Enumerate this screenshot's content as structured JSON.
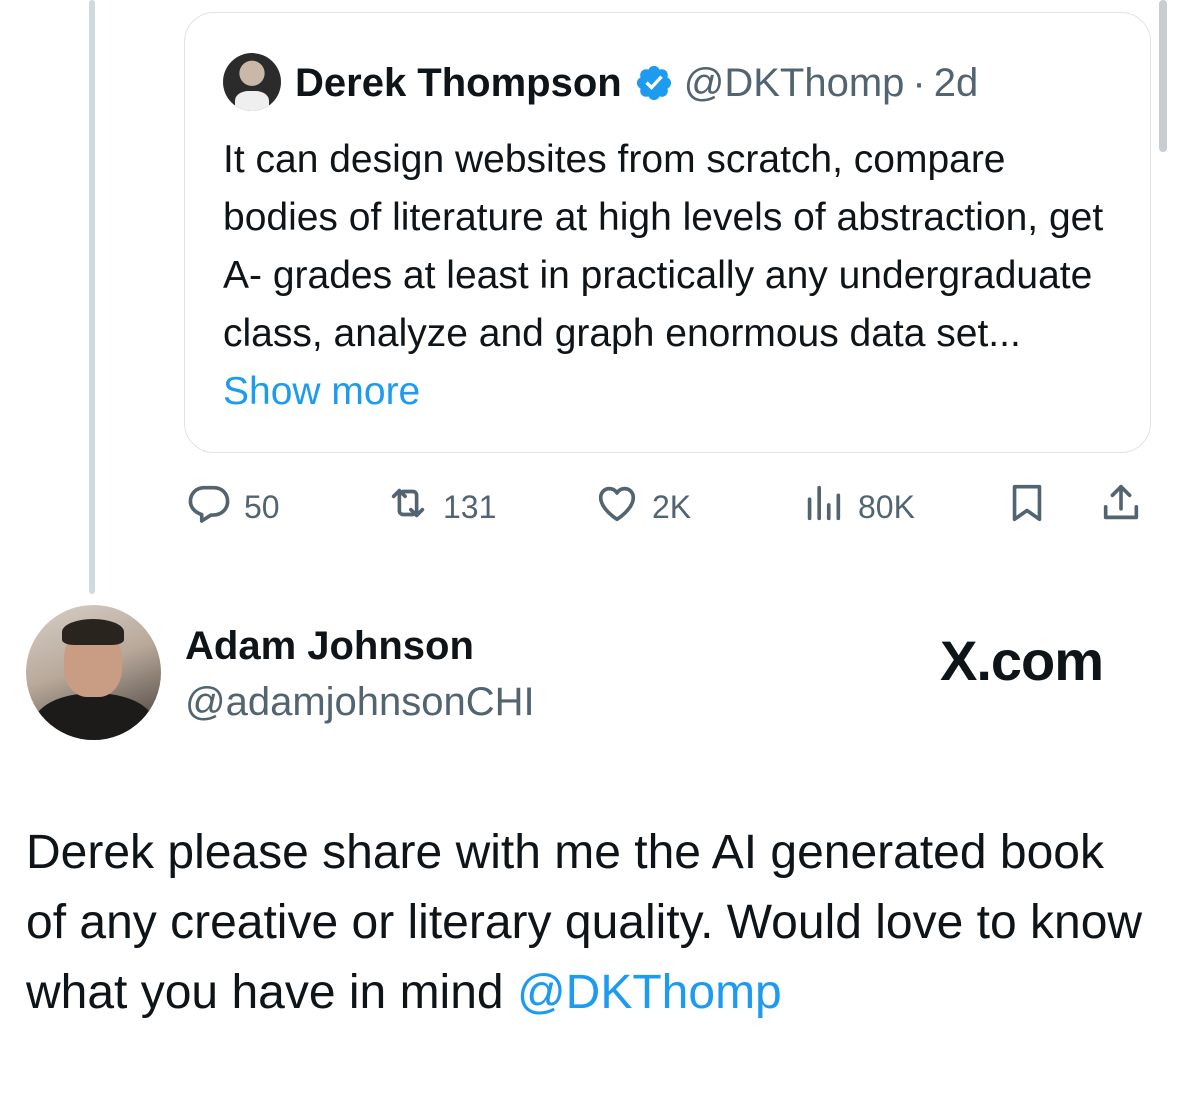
{
  "quoted_tweet": {
    "author_name": "Derek Thompson",
    "handle": "@DKThomp",
    "separator": "·",
    "time": "2d",
    "text": "It can design websites from scratch, compare bodies of literature at high levels of abstraction, get A- grades at least in practically any undergraduate class, analyze and graph enormous data set...",
    "show_more": "Show more",
    "verified_color": "#1d9bf0"
  },
  "actions": {
    "replies": "50",
    "reposts": "131",
    "likes": "2K",
    "views": "80K"
  },
  "reply": {
    "author_name": "Adam Johnson",
    "handle": "@adamjohnsonCHI",
    "brand": "X.com",
    "text": "Derek please share with me the AI generated book of any creative or literary quality. Would love to know what you have in mind ",
    "mention": "@DKThomp"
  },
  "colors": {
    "accent": "#1d9bf0",
    "secondary_text": "#536471",
    "primary_text": "#0f1419"
  },
  "icons": [
    "reply-icon",
    "repost-icon",
    "like-icon",
    "views-icon",
    "bookmark-icon",
    "share-icon",
    "verified-icon"
  ]
}
